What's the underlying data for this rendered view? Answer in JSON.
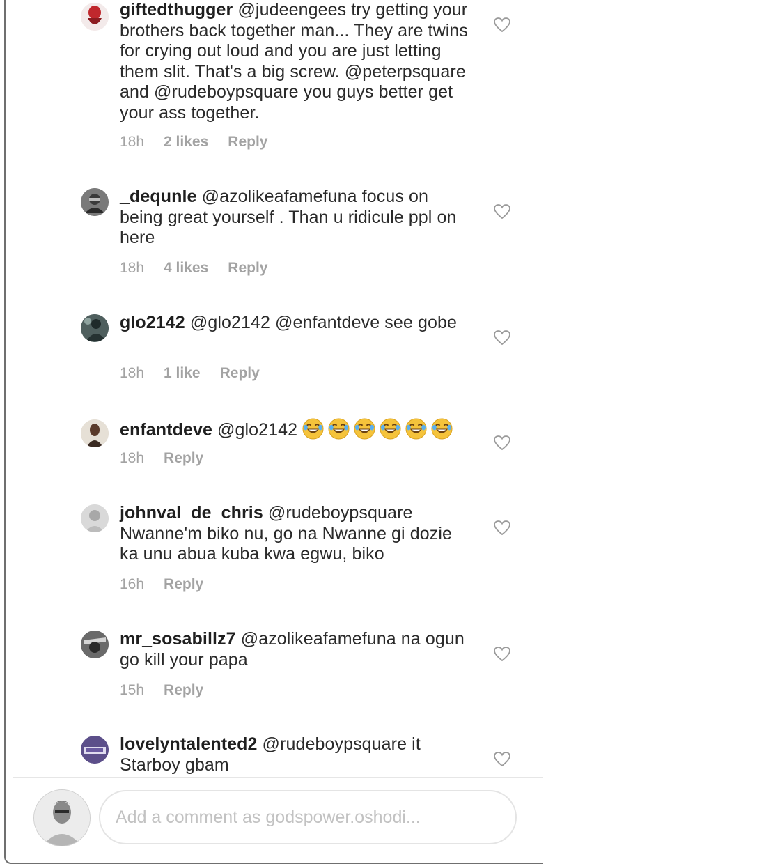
{
  "comments": [
    {
      "username": "giftedthugger",
      "text": "@judeengees try getting your brothers back together man... They are twins for crying out loud and you are just letting them slit. That's a big screw. @peterpsquare and @rudeboypsquare you guys better get your ass together.",
      "time": "18h",
      "likes": "2 likes",
      "reply": "Reply",
      "emoji_count": 0
    },
    {
      "username": "_dequnle",
      "text": "@azolikeafamefuna focus on being great yourself . Than u ridicule ppl on here",
      "time": "18h",
      "likes": "4 likes",
      "reply": "Reply",
      "emoji_count": 0
    },
    {
      "username": "glo2142",
      "text": "@glo2142 @enfantdeve see gobe",
      "time": "18h",
      "likes": "1 like",
      "reply": "Reply",
      "emoji_count": 0
    },
    {
      "username": "enfantdeve",
      "text": "@glo2142",
      "time": "18h",
      "likes": "",
      "reply": "Reply",
      "emoji_count": 6
    },
    {
      "username": "johnval_de_chris",
      "text": "@rudeboypsquare Nwanne'm biko nu, go na Nwanne gi dozie ka unu abua kuba kwa egwu, biko",
      "time": "16h",
      "likes": "",
      "reply": "Reply",
      "emoji_count": 0
    },
    {
      "username": "mr_sosabillz7",
      "text": "@azolikeafamefuna na ogun go kill your papa",
      "time": "15h",
      "likes": "",
      "reply": "Reply",
      "emoji_count": 0
    },
    {
      "username": "lovelyntalented2",
      "text": "@rudeboypsquare it Starboy gbam",
      "time": "",
      "likes": "",
      "reply": "",
      "emoji_count": 0
    }
  ],
  "emoji_icon": "face-with-tears-of-joy-icon",
  "composer": {
    "placeholder": "Add a comment as godspower.oshodi..."
  },
  "colors": {
    "text": "#262626",
    "meta": "#a3a3a3",
    "placeholder": "#c2c2c2",
    "heart_stroke": "#9a9a9a"
  }
}
